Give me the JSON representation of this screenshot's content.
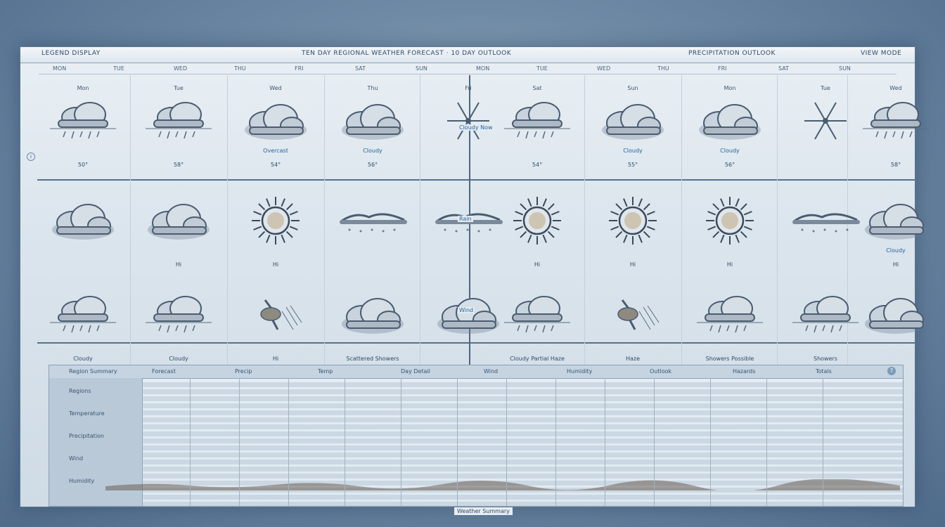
{
  "header": {
    "left_label": "LEGEND DISPLAY",
    "center_title": "TEN DAY REGIONAL WEATHER FORECAST · 10 DAY OUTLOOK",
    "right_label": "PRECIPITATION OUTLOOK",
    "far_right": "VIEW MODE",
    "sub_labels": [
      "MON",
      "TUE",
      "WED",
      "THU",
      "FRI",
      "SAT",
      "SUN",
      "MON",
      "TUE",
      "WED",
      "THU",
      "FRI",
      "SAT",
      "SUN"
    ]
  },
  "rows": [
    {
      "cells": [
        {
          "top": "Mon",
          "bottom": "50°",
          "mid": "",
          "icon": "cloud-rain-icon"
        },
        {
          "top": "Tue",
          "bottom": "58°",
          "mid": "",
          "icon": "cloud-rain-icon"
        },
        {
          "top": "Wed",
          "bottom": "54°",
          "mid": "Overcast",
          "icon": "cloud-icon"
        },
        {
          "top": "Thu",
          "bottom": "56°",
          "mid": "Cloudy",
          "icon": "cloud-icon"
        },
        {
          "top": "Fri",
          "bottom": "",
          "mid": "",
          "icon": "snowflake-icon"
        },
        {
          "top": "Sat",
          "bottom": "54°",
          "mid": "",
          "icon": "cloud-rain-icon"
        },
        {
          "top": "Sun",
          "bottom": "55°",
          "mid": "Cloudy",
          "icon": "cloud-icon"
        },
        {
          "top": "Mon",
          "bottom": "56°",
          "mid": "Cloudy",
          "icon": "cloud-icon"
        },
        {
          "top": "Tue",
          "bottom": "",
          "mid": "",
          "icon": "snowflake-icon"
        },
        {
          "top": "Wed",
          "bottom": "58°",
          "mid": "",
          "icon": "cloud-rain-icon"
        }
      ]
    },
    {
      "cells": [
        {
          "top": "",
          "bottom": "",
          "mid": "",
          "icon": "cloud-icon"
        },
        {
          "top": "",
          "bottom": "Hi",
          "mid": "",
          "icon": "cloud-icon"
        },
        {
          "top": "",
          "bottom": "Hi",
          "mid": "",
          "icon": "sun-icon"
        },
        {
          "top": "",
          "bottom": "",
          "mid": "",
          "icon": "fog-icon"
        },
        {
          "top": "",
          "bottom": "",
          "mid": "",
          "icon": "fog-icon"
        },
        {
          "top": "",
          "bottom": "Hi",
          "mid": "",
          "icon": "sun-icon"
        },
        {
          "top": "",
          "bottom": "Hi",
          "mid": "",
          "icon": "sun-icon"
        },
        {
          "top": "",
          "bottom": "Hi",
          "mid": "",
          "icon": "sun-icon"
        },
        {
          "top": "",
          "bottom": "",
          "mid": "",
          "icon": "fog-icon"
        },
        {
          "top": "",
          "bottom": "Hi",
          "mid": "Cloudy",
          "icon": "cloud-icon"
        }
      ]
    },
    {
      "cells": [
        {
          "top": "",
          "bottom": "Cloudy",
          "mid": "",
          "icon": "cloud-rain-icon"
        },
        {
          "top": "",
          "bottom": "Cloudy",
          "mid": "",
          "icon": "cloud-rain-icon"
        },
        {
          "top": "",
          "bottom": "Hi",
          "mid": "",
          "icon": "storm-icon"
        },
        {
          "top": "",
          "bottom": "Scattered Showers",
          "mid": "",
          "icon": "cloud-icon"
        },
        {
          "top": "",
          "bottom": "",
          "mid": "",
          "icon": "cloud-icon"
        },
        {
          "top": "",
          "bottom": "Cloudy Partial Haze",
          "mid": "",
          "icon": "cloud-rain-icon"
        },
        {
          "top": "",
          "bottom": "Haze",
          "mid": "",
          "icon": "storm-icon"
        },
        {
          "top": "",
          "bottom": "Showers Possible",
          "mid": "",
          "icon": "cloud-rain-icon"
        },
        {
          "top": "",
          "bottom": "Showers",
          "mid": "",
          "icon": "cloud-rain-icon"
        },
        {
          "top": "",
          "bottom": "",
          "mid": "",
          "icon": "cloud-icon"
        }
      ]
    }
  ],
  "center_marks": [
    "Cloudy Now",
    "Rain",
    "Wind"
  ],
  "tables": {
    "header_labels": [
      "Region Summary",
      "Forecast",
      "Precip",
      "Temp",
      "Day Detail",
      "Wind",
      "Humidity",
      "Outlook",
      "Hazards",
      "Totals"
    ],
    "side_labels": [
      "Regions",
      "Temperature",
      "Precipitation",
      "Wind",
      "Humidity"
    ],
    "row_count": 18
  },
  "footer": "Weather Summary"
}
